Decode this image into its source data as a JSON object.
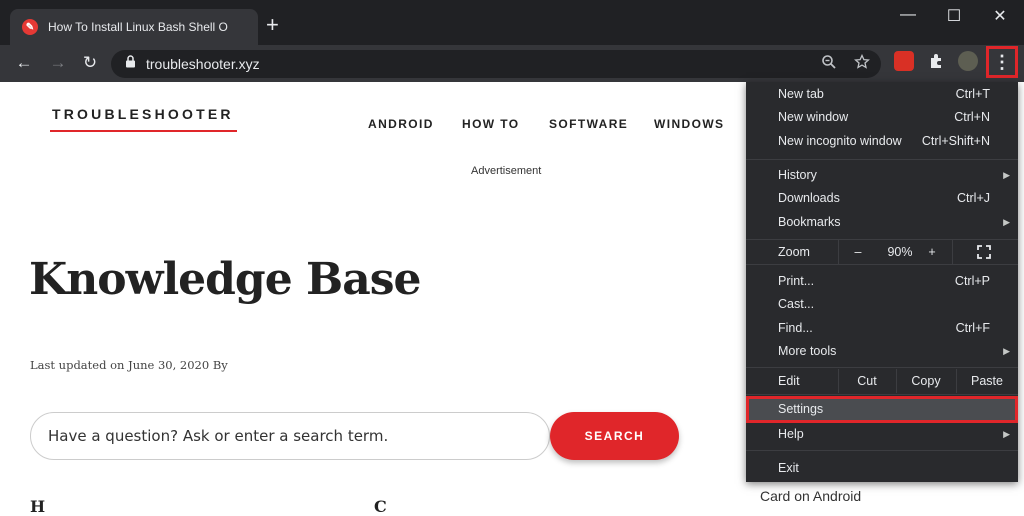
{
  "browser": {
    "tab_title": "How To Install Linux Bash Shell O",
    "tab_favicon_glyph": "✎",
    "new_tab_glyph": "+",
    "window_controls": {
      "minimize": "—",
      "maximize": "☐",
      "close": "✕"
    },
    "nav": {
      "back": "←",
      "forward": "→",
      "reload": "↻"
    },
    "url": "troubleshooter.xyz",
    "icons": {
      "lock": "lock-icon",
      "zoom": "zoom-icon",
      "star": "star-icon",
      "menu": "kebab-menu-icon"
    },
    "menu_glyph": "⋮",
    "accent_red": "#e0262a"
  },
  "site": {
    "logo": "TROUBLESHOOTER",
    "nav": [
      "ANDROID",
      "HOW TO",
      "SOFTWARE",
      "WINDOWS"
    ],
    "advertisement": "Advertisement",
    "title": "Knowledge Base",
    "updated": "Last updated on June 30, 2020 By",
    "search_placeholder": "Have a question? Ask or enter a search term.",
    "search_button": "SEARCH",
    "card_android": "Card on Android",
    "frag_left": "H",
    "frag_mid": "C"
  },
  "menu": {
    "new_tab": {
      "label": "New tab",
      "shortcut": "Ctrl+T"
    },
    "new_window": {
      "label": "New window",
      "shortcut": "Ctrl+N"
    },
    "incognito": {
      "label": "New incognito window",
      "shortcut": "Ctrl+Shift+N"
    },
    "history": {
      "label": "History"
    },
    "downloads": {
      "label": "Downloads",
      "shortcut": "Ctrl+J"
    },
    "bookmarks": {
      "label": "Bookmarks"
    },
    "zoom": {
      "label": "Zoom",
      "minus": "–",
      "value": "90%",
      "plus": "+",
      "fullscreen": "⛶"
    },
    "print": {
      "label": "Print...",
      "shortcut": "Ctrl+P"
    },
    "cast": {
      "label": "Cast..."
    },
    "find": {
      "label": "Find...",
      "shortcut": "Ctrl+F"
    },
    "more_tools": {
      "label": "More tools"
    },
    "edit": {
      "label": "Edit",
      "cut": "Cut",
      "copy": "Copy",
      "paste": "Paste"
    },
    "settings": {
      "label": "Settings"
    },
    "help": {
      "label": "Help"
    },
    "exit": {
      "label": "Exit"
    },
    "submenu_arrow": "▶"
  }
}
